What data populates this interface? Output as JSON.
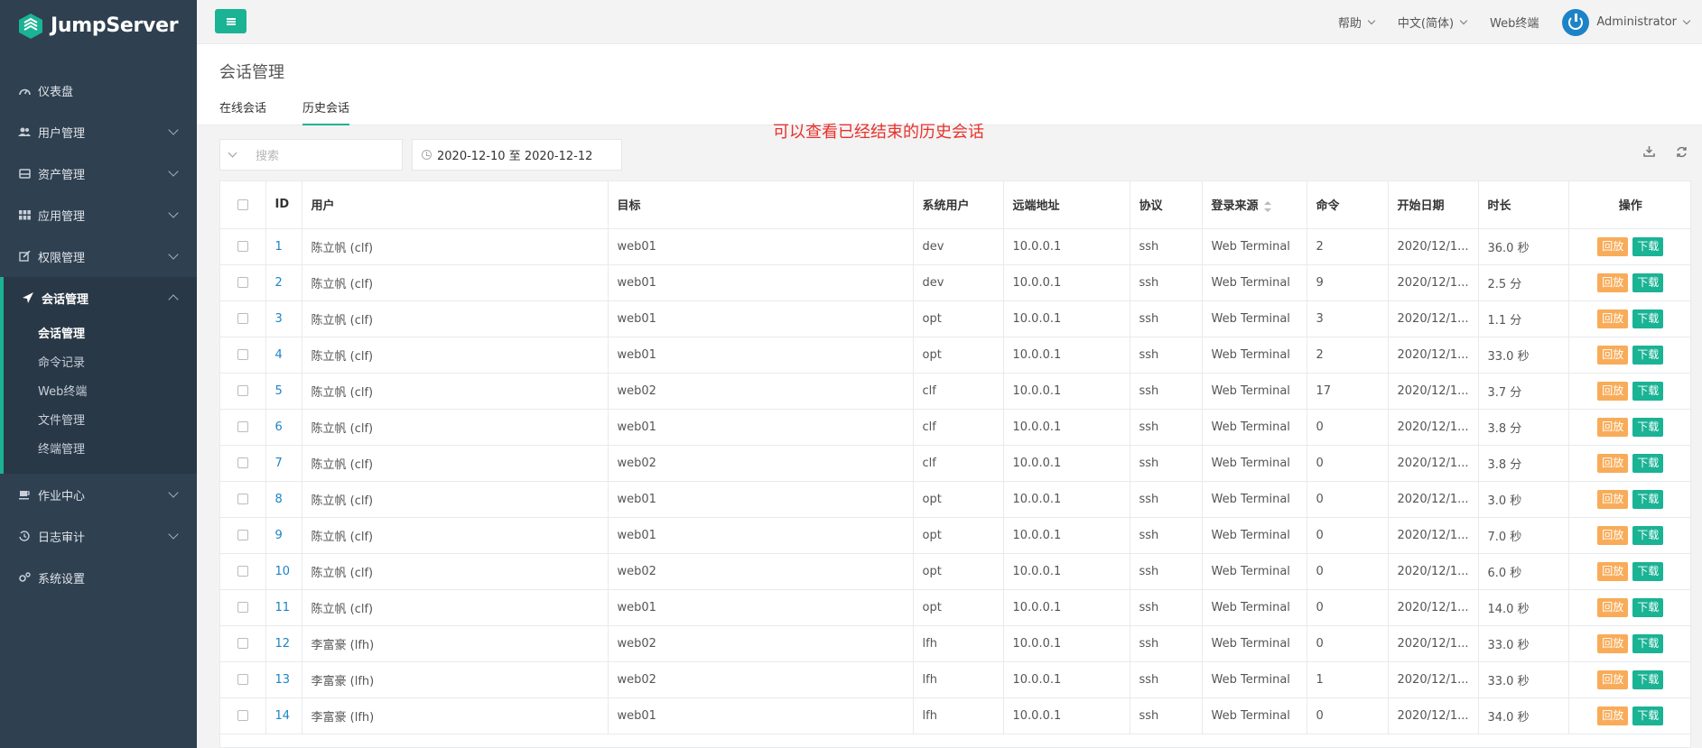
{
  "app": {
    "name": "JumpServer"
  },
  "sidebar": {
    "items": [
      {
        "label": "仪表盘",
        "icon": "dashboard-icon",
        "has_children": false
      },
      {
        "label": "用户管理",
        "icon": "users-icon",
        "has_children": true
      },
      {
        "label": "资产管理",
        "icon": "inbox-icon",
        "has_children": true
      },
      {
        "label": "应用管理",
        "icon": "grid-icon",
        "has_children": true
      },
      {
        "label": "权限管理",
        "icon": "edit-icon",
        "has_children": true
      },
      {
        "label": "会话管理",
        "icon": "rocket-icon",
        "has_children": true,
        "expanded": true
      },
      {
        "label": "作业中心",
        "icon": "coffee-icon",
        "has_children": true
      },
      {
        "label": "日志审计",
        "icon": "history-icon",
        "has_children": true
      },
      {
        "label": "系统设置",
        "icon": "gears-icon",
        "has_children": false
      }
    ],
    "session_submenu": [
      "会话管理",
      "命令记录",
      "Web终端",
      "文件管理",
      "终端管理"
    ],
    "current_submenu": "会话管理"
  },
  "topbar": {
    "help": "帮助",
    "language": "中文(简体)",
    "web_terminal": "Web终端",
    "user": "Administrator"
  },
  "page": {
    "title": "会话管理",
    "tabs": [
      "在线会话",
      "历史会话"
    ],
    "active_tab": "历史会话",
    "annotation": "可以查看已经结束的历史会话"
  },
  "toolbar": {
    "search_placeholder": "搜索",
    "date_range": "2020-12-10 至 2020-12-12"
  },
  "table": {
    "headers": [
      "ID",
      "用户",
      "目标",
      "系统用户",
      "远端地址",
      "协议",
      "登录来源",
      "命令",
      "开始日期",
      "时长",
      "操作"
    ],
    "action_labels": {
      "replay": "回放",
      "download": "下载"
    },
    "rows": [
      {
        "id": "1",
        "user": "陈立帆 (clf)",
        "target": "web01",
        "system_user": "dev",
        "remote_addr": "10.0.0.1",
        "protocol": "ssh",
        "login_from": "Web Terminal",
        "commands": "2",
        "date_start": "2020/12/1...",
        "duration": "36.0 秒"
      },
      {
        "id": "2",
        "user": "陈立帆 (clf)",
        "target": "web01",
        "system_user": "dev",
        "remote_addr": "10.0.0.1",
        "protocol": "ssh",
        "login_from": "Web Terminal",
        "commands": "9",
        "date_start": "2020/12/1...",
        "duration": "2.5 分"
      },
      {
        "id": "3",
        "user": "陈立帆 (clf)",
        "target": "web01",
        "system_user": "opt",
        "remote_addr": "10.0.0.1",
        "protocol": "ssh",
        "login_from": "Web Terminal",
        "commands": "3",
        "date_start": "2020/12/1...",
        "duration": "1.1 分"
      },
      {
        "id": "4",
        "user": "陈立帆 (clf)",
        "target": "web01",
        "system_user": "opt",
        "remote_addr": "10.0.0.1",
        "protocol": "ssh",
        "login_from": "Web Terminal",
        "commands": "2",
        "date_start": "2020/12/1...",
        "duration": "33.0 秒"
      },
      {
        "id": "5",
        "user": "陈立帆 (clf)",
        "target": "web02",
        "system_user": "clf",
        "remote_addr": "10.0.0.1",
        "protocol": "ssh",
        "login_from": "Web Terminal",
        "commands": "17",
        "date_start": "2020/12/1...",
        "duration": "3.7 分"
      },
      {
        "id": "6",
        "user": "陈立帆 (clf)",
        "target": "web01",
        "system_user": "clf",
        "remote_addr": "10.0.0.1",
        "protocol": "ssh",
        "login_from": "Web Terminal",
        "commands": "0",
        "date_start": "2020/12/1...",
        "duration": "3.8 分"
      },
      {
        "id": "7",
        "user": "陈立帆 (clf)",
        "target": "web02",
        "system_user": "clf",
        "remote_addr": "10.0.0.1",
        "protocol": "ssh",
        "login_from": "Web Terminal",
        "commands": "0",
        "date_start": "2020/12/1...",
        "duration": "3.8 分"
      },
      {
        "id": "8",
        "user": "陈立帆 (clf)",
        "target": "web01",
        "system_user": "opt",
        "remote_addr": "10.0.0.1",
        "protocol": "ssh",
        "login_from": "Web Terminal",
        "commands": "0",
        "date_start": "2020/12/1...",
        "duration": "3.0 秒"
      },
      {
        "id": "9",
        "user": "陈立帆 (clf)",
        "target": "web01",
        "system_user": "opt",
        "remote_addr": "10.0.0.1",
        "protocol": "ssh",
        "login_from": "Web Terminal",
        "commands": "0",
        "date_start": "2020/12/1...",
        "duration": "7.0 秒"
      },
      {
        "id": "10",
        "user": "陈立帆 (clf)",
        "target": "web02",
        "system_user": "opt",
        "remote_addr": "10.0.0.1",
        "protocol": "ssh",
        "login_from": "Web Terminal",
        "commands": "0",
        "date_start": "2020/12/1...",
        "duration": "6.0 秒"
      },
      {
        "id": "11",
        "user": "陈立帆 (clf)",
        "target": "web01",
        "system_user": "opt",
        "remote_addr": "10.0.0.1",
        "protocol": "ssh",
        "login_from": "Web Terminal",
        "commands": "0",
        "date_start": "2020/12/1...",
        "duration": "14.0 秒"
      },
      {
        "id": "12",
        "user": "李富豪 (lfh)",
        "target": "web02",
        "system_user": "lfh",
        "remote_addr": "10.0.0.1",
        "protocol": "ssh",
        "login_from": "Web Terminal",
        "commands": "0",
        "date_start": "2020/12/1...",
        "duration": "33.0 秒"
      },
      {
        "id": "13",
        "user": "李富豪 (lfh)",
        "target": "web02",
        "system_user": "lfh",
        "remote_addr": "10.0.0.1",
        "protocol": "ssh",
        "login_from": "Web Terminal",
        "commands": "1",
        "date_start": "2020/12/1...",
        "duration": "33.0 秒"
      },
      {
        "id": "14",
        "user": "李富豪 (lfh)",
        "target": "web01",
        "system_user": "lfh",
        "remote_addr": "10.0.0.1",
        "protocol": "ssh",
        "login_from": "Web Terminal",
        "commands": "0",
        "date_start": "2020/12/1...",
        "duration": "34.0 秒"
      }
    ]
  },
  "colors": {
    "sidebar_bg": "#2f4050",
    "accent": "#1ab394",
    "replay": "#f8ac59",
    "link": "#1c84c6",
    "annotation": "#e8322c"
  }
}
